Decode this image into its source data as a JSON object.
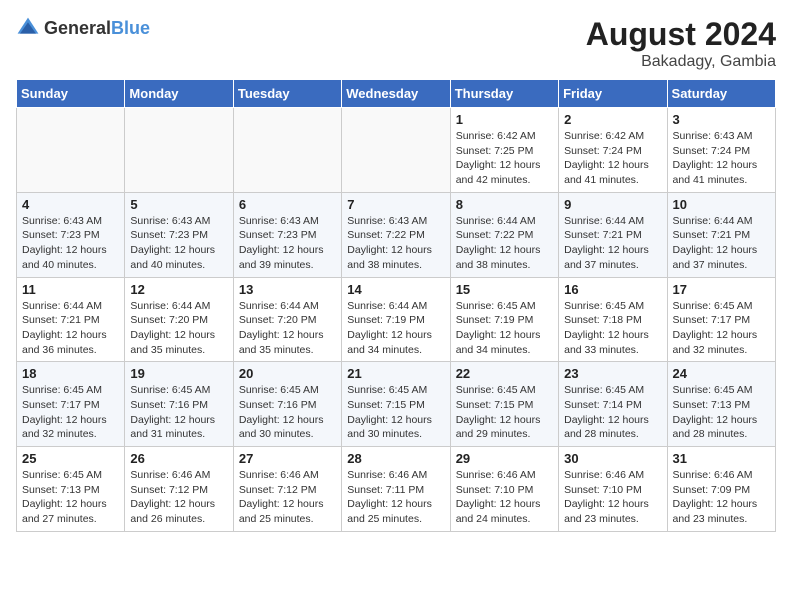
{
  "header": {
    "logo_general": "General",
    "logo_blue": "Blue",
    "month_year": "August 2024",
    "location": "Bakadagy, Gambia"
  },
  "weekdays": [
    "Sunday",
    "Monday",
    "Tuesday",
    "Wednesday",
    "Thursday",
    "Friday",
    "Saturday"
  ],
  "weeks": [
    [
      {
        "day": "",
        "info": ""
      },
      {
        "day": "",
        "info": ""
      },
      {
        "day": "",
        "info": ""
      },
      {
        "day": "",
        "info": ""
      },
      {
        "day": "1",
        "info": "Sunrise: 6:42 AM\nSunset: 7:25 PM\nDaylight: 12 hours\nand 42 minutes."
      },
      {
        "day": "2",
        "info": "Sunrise: 6:42 AM\nSunset: 7:24 PM\nDaylight: 12 hours\nand 41 minutes."
      },
      {
        "day": "3",
        "info": "Sunrise: 6:43 AM\nSunset: 7:24 PM\nDaylight: 12 hours\nand 41 minutes."
      }
    ],
    [
      {
        "day": "4",
        "info": "Sunrise: 6:43 AM\nSunset: 7:23 PM\nDaylight: 12 hours\nand 40 minutes."
      },
      {
        "day": "5",
        "info": "Sunrise: 6:43 AM\nSunset: 7:23 PM\nDaylight: 12 hours\nand 40 minutes."
      },
      {
        "day": "6",
        "info": "Sunrise: 6:43 AM\nSunset: 7:23 PM\nDaylight: 12 hours\nand 39 minutes."
      },
      {
        "day": "7",
        "info": "Sunrise: 6:43 AM\nSunset: 7:22 PM\nDaylight: 12 hours\nand 38 minutes."
      },
      {
        "day": "8",
        "info": "Sunrise: 6:44 AM\nSunset: 7:22 PM\nDaylight: 12 hours\nand 38 minutes."
      },
      {
        "day": "9",
        "info": "Sunrise: 6:44 AM\nSunset: 7:21 PM\nDaylight: 12 hours\nand 37 minutes."
      },
      {
        "day": "10",
        "info": "Sunrise: 6:44 AM\nSunset: 7:21 PM\nDaylight: 12 hours\nand 37 minutes."
      }
    ],
    [
      {
        "day": "11",
        "info": "Sunrise: 6:44 AM\nSunset: 7:21 PM\nDaylight: 12 hours\nand 36 minutes."
      },
      {
        "day": "12",
        "info": "Sunrise: 6:44 AM\nSunset: 7:20 PM\nDaylight: 12 hours\nand 35 minutes."
      },
      {
        "day": "13",
        "info": "Sunrise: 6:44 AM\nSunset: 7:20 PM\nDaylight: 12 hours\nand 35 minutes."
      },
      {
        "day": "14",
        "info": "Sunrise: 6:44 AM\nSunset: 7:19 PM\nDaylight: 12 hours\nand 34 minutes."
      },
      {
        "day": "15",
        "info": "Sunrise: 6:45 AM\nSunset: 7:19 PM\nDaylight: 12 hours\nand 34 minutes."
      },
      {
        "day": "16",
        "info": "Sunrise: 6:45 AM\nSunset: 7:18 PM\nDaylight: 12 hours\nand 33 minutes."
      },
      {
        "day": "17",
        "info": "Sunrise: 6:45 AM\nSunset: 7:17 PM\nDaylight: 12 hours\nand 32 minutes."
      }
    ],
    [
      {
        "day": "18",
        "info": "Sunrise: 6:45 AM\nSunset: 7:17 PM\nDaylight: 12 hours\nand 32 minutes."
      },
      {
        "day": "19",
        "info": "Sunrise: 6:45 AM\nSunset: 7:16 PM\nDaylight: 12 hours\nand 31 minutes."
      },
      {
        "day": "20",
        "info": "Sunrise: 6:45 AM\nSunset: 7:16 PM\nDaylight: 12 hours\nand 30 minutes."
      },
      {
        "day": "21",
        "info": "Sunrise: 6:45 AM\nSunset: 7:15 PM\nDaylight: 12 hours\nand 30 minutes."
      },
      {
        "day": "22",
        "info": "Sunrise: 6:45 AM\nSunset: 7:15 PM\nDaylight: 12 hours\nand 29 minutes."
      },
      {
        "day": "23",
        "info": "Sunrise: 6:45 AM\nSunset: 7:14 PM\nDaylight: 12 hours\nand 28 minutes."
      },
      {
        "day": "24",
        "info": "Sunrise: 6:45 AM\nSunset: 7:13 PM\nDaylight: 12 hours\nand 28 minutes."
      }
    ],
    [
      {
        "day": "25",
        "info": "Sunrise: 6:45 AM\nSunset: 7:13 PM\nDaylight: 12 hours\nand 27 minutes."
      },
      {
        "day": "26",
        "info": "Sunrise: 6:46 AM\nSunset: 7:12 PM\nDaylight: 12 hours\nand 26 minutes."
      },
      {
        "day": "27",
        "info": "Sunrise: 6:46 AM\nSunset: 7:12 PM\nDaylight: 12 hours\nand 25 minutes."
      },
      {
        "day": "28",
        "info": "Sunrise: 6:46 AM\nSunset: 7:11 PM\nDaylight: 12 hours\nand 25 minutes."
      },
      {
        "day": "29",
        "info": "Sunrise: 6:46 AM\nSunset: 7:10 PM\nDaylight: 12 hours\nand 24 minutes."
      },
      {
        "day": "30",
        "info": "Sunrise: 6:46 AM\nSunset: 7:10 PM\nDaylight: 12 hours\nand 23 minutes."
      },
      {
        "day": "31",
        "info": "Sunrise: 6:46 AM\nSunset: 7:09 PM\nDaylight: 12 hours\nand 23 minutes."
      }
    ]
  ]
}
